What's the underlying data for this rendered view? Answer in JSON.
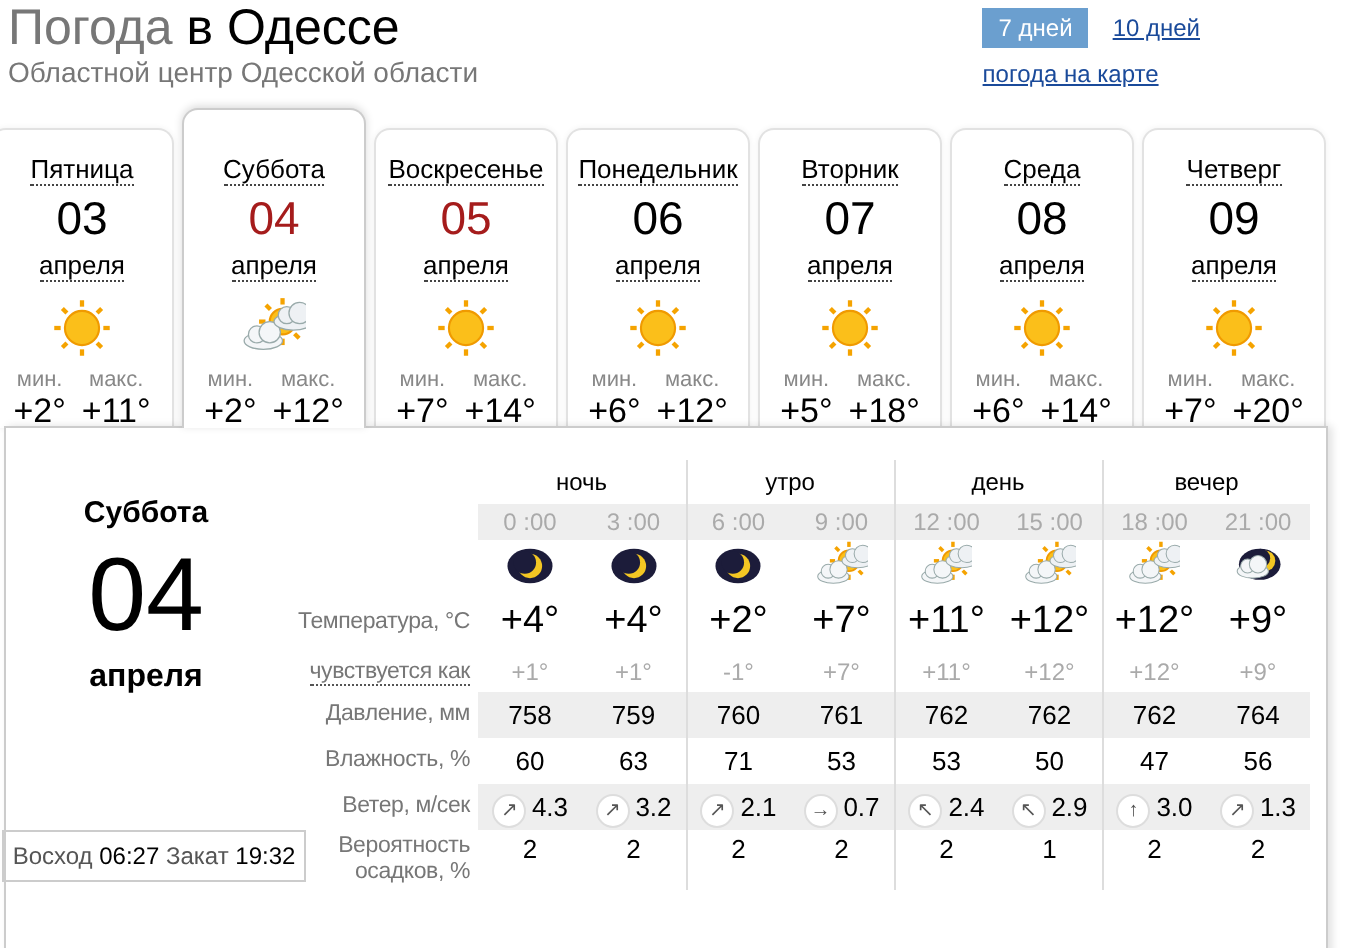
{
  "header": {
    "title_lead": "Погода",
    "title_place": "в Одессе",
    "subtitle": "Областной центр Одесской области"
  },
  "range_tabs": [
    {
      "label": "7 дней",
      "selected": true
    },
    {
      "label": "10 дней",
      "selected": false
    }
  ],
  "map_link": "погода на карте",
  "days": [
    {
      "weekday": "Пятница",
      "day": "03",
      "month": "апреля",
      "weekend": false,
      "selected": false,
      "kind": "sun",
      "min_label": "мин.",
      "min": "+2°",
      "max_label": "макс.",
      "max": "+11°"
    },
    {
      "weekday": "Суббота",
      "day": "04",
      "month": "апреля",
      "weekend": true,
      "selected": true,
      "kind": "sun_cloud",
      "min_label": "мин.",
      "min": "+2°",
      "max_label": "макс.",
      "max": "+12°"
    },
    {
      "weekday": "Воскресенье",
      "day": "05",
      "month": "апреля",
      "weekend": true,
      "selected": false,
      "kind": "sun",
      "min_label": "мин.",
      "min": "+7°",
      "max_label": "макс.",
      "max": "+14°"
    },
    {
      "weekday": "Понедельник",
      "day": "06",
      "month": "апреля",
      "weekend": false,
      "selected": false,
      "kind": "sun",
      "min_label": "мин.",
      "min": "+6°",
      "max_label": "макс.",
      "max": "+12°"
    },
    {
      "weekday": "Вторник",
      "day": "07",
      "month": "апреля",
      "weekend": false,
      "selected": false,
      "kind": "sun",
      "min_label": "мин.",
      "min": "+5°",
      "max_label": "макс.",
      "max": "+18°"
    },
    {
      "weekday": "Среда",
      "day": "08",
      "month": "апреля",
      "weekend": false,
      "selected": false,
      "kind": "sun",
      "min_label": "мин.",
      "min": "+6°",
      "max_label": "макс.",
      "max": "+14°"
    },
    {
      "weekday": "Четверг",
      "day": "09",
      "month": "апреля",
      "weekend": false,
      "selected": false,
      "kind": "sun",
      "min_label": "мин.",
      "min": "+7°",
      "max_label": "макс.",
      "max": "+20°"
    }
  ],
  "detail": {
    "weekday": "Суббота",
    "day": "04",
    "month": "апреля",
    "sunrise_label": "Восход",
    "sunrise": "06:27",
    "sunset_label": "Закат",
    "sunset": "19:32",
    "row_labels": [
      {
        "text": "Температура, °C",
        "hint": false
      },
      {
        "text": "чувствуется как",
        "hint": true
      },
      {
        "text": "Давление, мм",
        "hint": false
      },
      {
        "text": "Влажность, %",
        "hint": false
      },
      {
        "text": "Ветер, м/сек",
        "hint": false
      },
      {
        "text": "Вероятность осадков, %",
        "hint": false
      }
    ],
    "periods": [
      {
        "label": "ночь",
        "hours": [
          {
            "time": "0 :00",
            "kind": "moon",
            "temp": "+4°",
            "feels": "+1°",
            "pressure": "758",
            "humidity": "60",
            "wind_arrow": "↗",
            "wind": "4.3",
            "precip": "2"
          },
          {
            "time": "3 :00",
            "kind": "moon",
            "temp": "+4°",
            "feels": "+1°",
            "pressure": "759",
            "humidity": "63",
            "wind_arrow": "↗",
            "wind": "3.2",
            "precip": "2"
          }
        ]
      },
      {
        "label": "утро",
        "hours": [
          {
            "time": "6 :00",
            "kind": "moon",
            "temp": "+2°",
            "feels": "-1°",
            "pressure": "760",
            "humidity": "71",
            "wind_arrow": "↗",
            "wind": "2.1",
            "precip": "2"
          },
          {
            "time": "9 :00",
            "kind": "sun_cloud",
            "temp": "+7°",
            "feels": "+7°",
            "pressure": "761",
            "humidity": "53",
            "wind_arrow": "→",
            "wind": "0.7",
            "precip": "2"
          }
        ]
      },
      {
        "label": "день",
        "hours": [
          {
            "time": "12 :00",
            "kind": "sun_cloud",
            "temp": "+11°",
            "feels": "+11°",
            "pressure": "762",
            "humidity": "53",
            "wind_arrow": "↖",
            "wind": "2.4",
            "precip": "2"
          },
          {
            "time": "15 :00",
            "kind": "sun_cloud",
            "temp": "+12°",
            "feels": "+12°",
            "pressure": "762",
            "humidity": "50",
            "wind_arrow": "↖",
            "wind": "2.9",
            "precip": "1"
          }
        ]
      },
      {
        "label": "вечер",
        "hours": [
          {
            "time": "18 :00",
            "kind": "sun_cloud",
            "temp": "+12°",
            "feels": "+12°",
            "pressure": "762",
            "humidity": "47",
            "wind_arrow": "↑",
            "wind": "3.0",
            "precip": "2"
          },
          {
            "time": "21 :00",
            "kind": "moon_cloud",
            "temp": "+9°",
            "feels": "+9°",
            "pressure": "764",
            "humidity": "56",
            "wind_arrow": "↗",
            "wind": "1.3",
            "precip": "2"
          }
        ]
      }
    ]
  }
}
